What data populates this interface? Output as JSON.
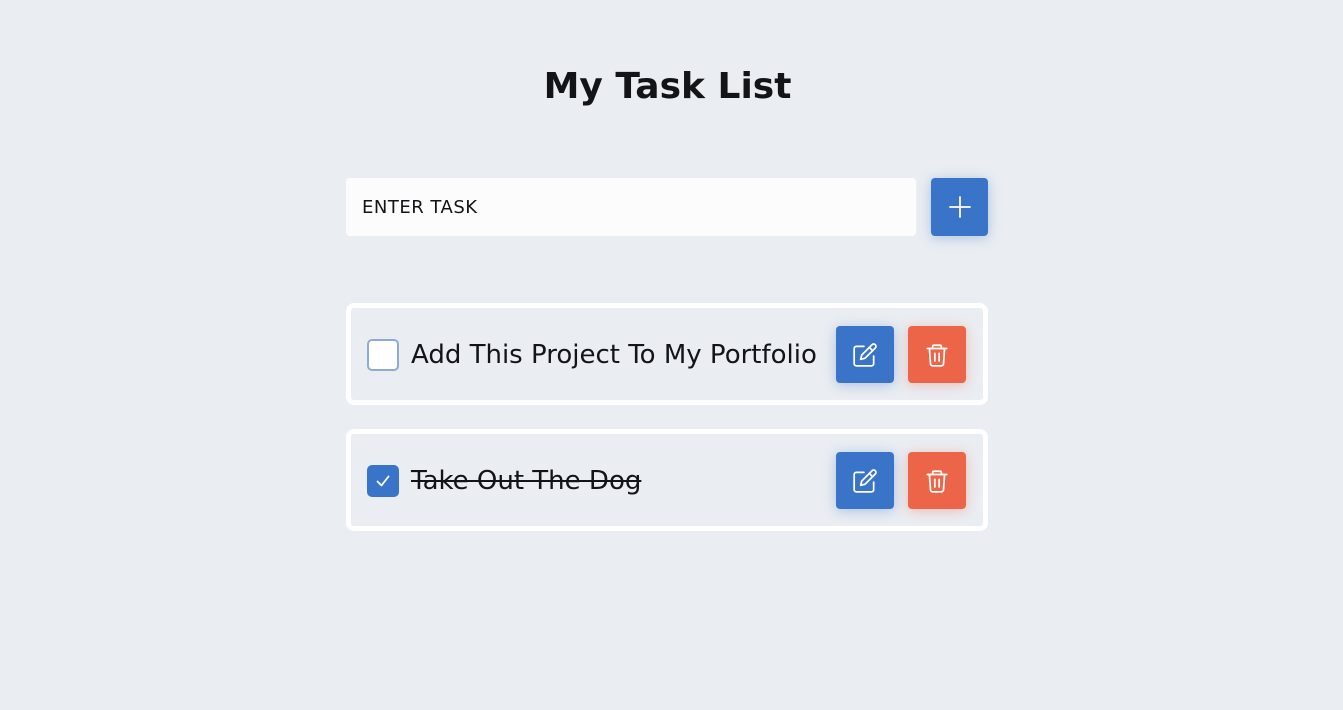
{
  "header": {
    "title": "My Task List"
  },
  "new_task": {
    "placeholder": "ENTER TASK",
    "add_icon": "plus-icon"
  },
  "tasks": [
    {
      "text": "Add This Project To My Portfolio",
      "completed": false,
      "edit_icon": "edit-icon",
      "delete_icon": "trash-icon"
    },
    {
      "text": "Take Out The Dog",
      "completed": true,
      "edit_icon": "edit-icon",
      "delete_icon": "trash-icon"
    }
  ],
  "colors": {
    "background": "#eaedf2",
    "primary": "#3a74c9",
    "danger": "#ec6548",
    "text": "#121418"
  }
}
